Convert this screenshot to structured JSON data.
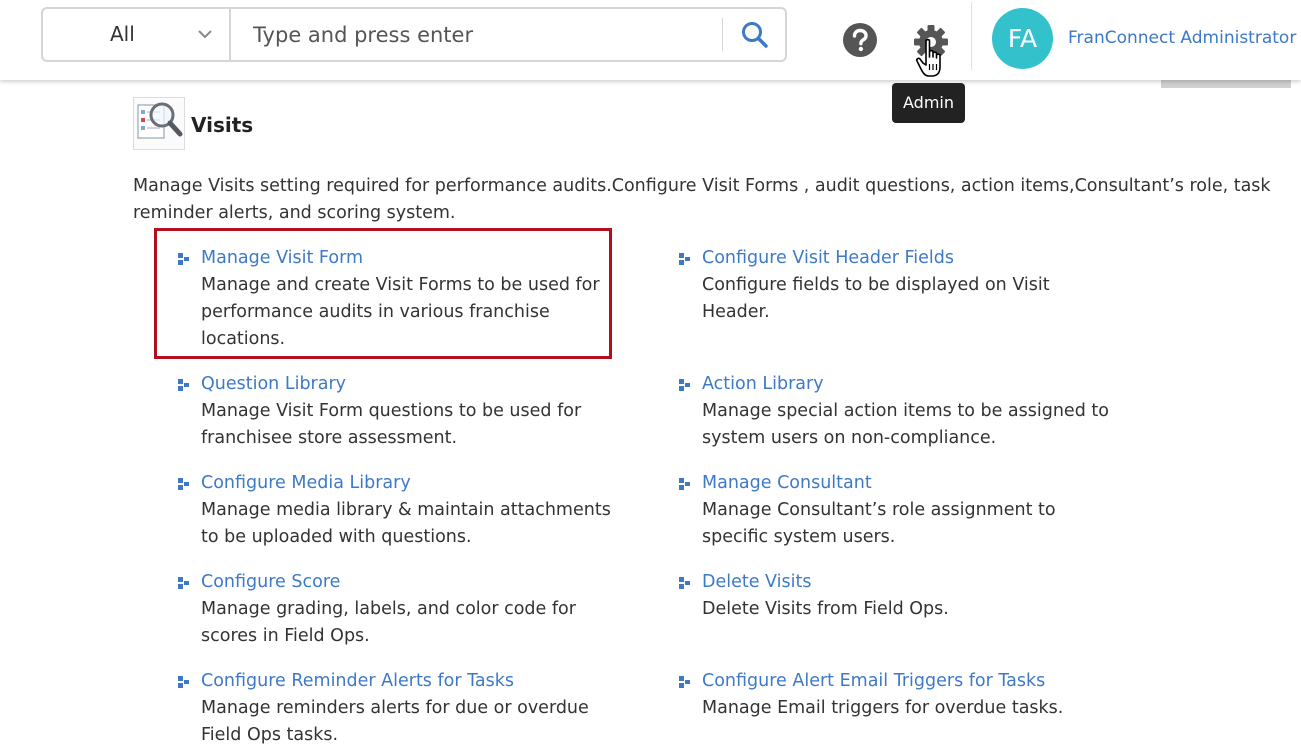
{
  "topbar": {
    "search": {
      "scope_value": "All",
      "placeholder": "Type and press enter"
    },
    "admin_tooltip": "Admin",
    "avatar_initials": "FA",
    "user_name": "FranConnect Administrator"
  },
  "section": {
    "title": "Visits",
    "description": "Manage Visits setting required for performance audits.Configure Visit Forms , audit questions, action items,Consultant’s role, task reminder alerts, and scoring system."
  },
  "items": [
    {
      "title": "Manage Visit Form",
      "desc": "Manage and create Visit Forms to be used for performance audits in various franchise locations."
    },
    {
      "title": "Configure Visit Header Fields",
      "desc": "Configure fields to be displayed on Visit Header."
    },
    {
      "title": "Question Library",
      "desc": "Manage Visit Form questions to be used for franchisee store assessment."
    },
    {
      "title": "Action Library",
      "desc": "Manage special action items to be assigned to system users on non-compliance."
    },
    {
      "title": "Configure Media Library",
      "desc": "Manage media library & maintain attachments to be uploaded with questions."
    },
    {
      "title": "Manage Consultant",
      "desc": "Manage Consultant’s role assignment to specific system users."
    },
    {
      "title": "Configure Score",
      "desc": "Manage grading, labels, and color code for scores in Field Ops."
    },
    {
      "title": "Delete Visits",
      "desc": "Delete Visits from Field Ops."
    },
    {
      "title": "Configure Reminder Alerts for Tasks",
      "desc": "Manage reminders alerts for due or overdue Field Ops tasks."
    },
    {
      "title": "Configure Alert Email Triggers for Tasks",
      "desc": "Manage Email triggers for overdue tasks."
    }
  ],
  "colors": {
    "link": "#3d79c7",
    "avatar": "#33c2cc",
    "highlight": "#b20f1d",
    "tooltip_bg": "#222222"
  },
  "icons": {
    "search": "search-icon",
    "help": "help-icon",
    "settings": "gear-icon",
    "bullet": "bullet-icon",
    "section": "visits-magnifier-icon",
    "cursor": "hand-cursor-icon"
  }
}
